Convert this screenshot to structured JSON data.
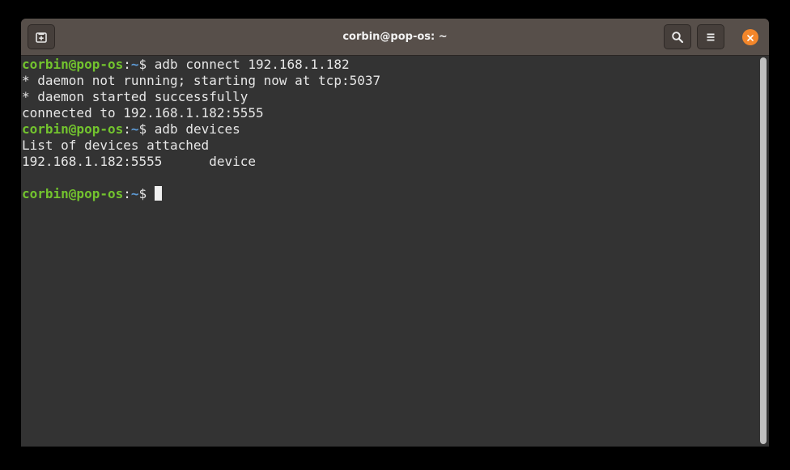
{
  "window": {
    "title": "corbin@pop-os: ~"
  },
  "terminal": {
    "lines": [
      {
        "type": "prompt",
        "user": "corbin@pop-os",
        "sep": ":",
        "path": "~",
        "symbol": "$ ",
        "command": "adb connect 192.168.1.182"
      },
      {
        "type": "output",
        "text": "* daemon not running; starting now at tcp:5037"
      },
      {
        "type": "output",
        "text": "* daemon started successfully"
      },
      {
        "type": "output",
        "text": "connected to 192.168.1.182:5555"
      },
      {
        "type": "prompt",
        "user": "corbin@pop-os",
        "sep": ":",
        "path": "~",
        "symbol": "$ ",
        "command": "adb devices"
      },
      {
        "type": "output",
        "text": "List of devices attached"
      },
      {
        "type": "output",
        "text": "192.168.1.182:5555      device"
      },
      {
        "type": "output",
        "text": ""
      },
      {
        "type": "prompt",
        "user": "corbin@pop-os",
        "sep": ":",
        "path": "~",
        "symbol": "$ ",
        "command": ""
      }
    ]
  },
  "icons": {
    "new_tab": "new-tab-icon",
    "search": "search-icon",
    "menu": "hamburger-menu-icon",
    "close": "close-icon"
  },
  "colors": {
    "titlebar": "#574f4a",
    "terminal_bg": "#333333",
    "prompt_user": "#73c42e",
    "prompt_path": "#5e9bd6",
    "close_button": "#f3862a"
  }
}
